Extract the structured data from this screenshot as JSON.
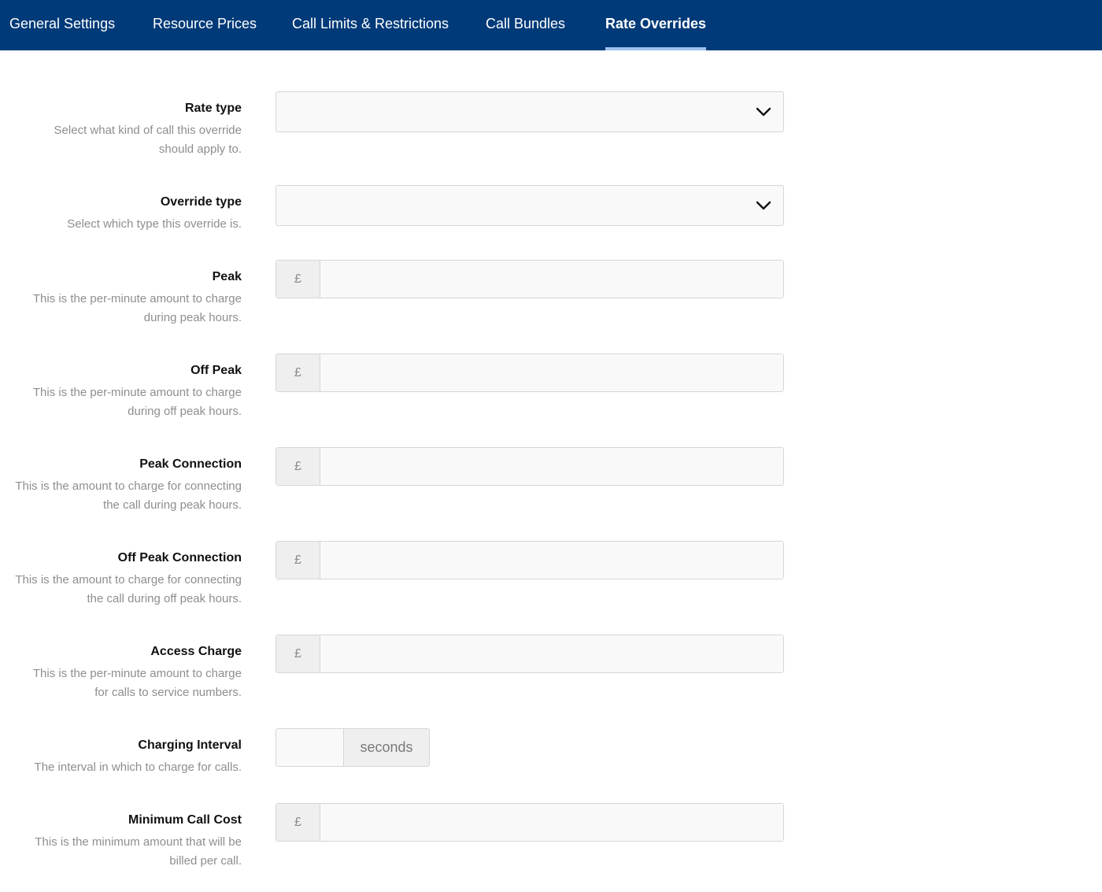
{
  "nav": {
    "tabs": [
      {
        "label": "General Settings"
      },
      {
        "label": "Resource Prices"
      },
      {
        "label": "Call Limits & Restrictions"
      },
      {
        "label": "Call Bundles"
      },
      {
        "label": "Rate Overrides"
      }
    ],
    "active_tab": "Rate Overrides"
  },
  "form": {
    "rate_type": {
      "label": "Rate type",
      "help": "Select what kind of call this override should apply to.",
      "value": ""
    },
    "override_type": {
      "label": "Override type",
      "help": "Select which type this override is.",
      "value": ""
    },
    "peak": {
      "label": "Peak",
      "help": "This is the per-minute amount to charge during peak hours.",
      "prefix": "£",
      "value": ""
    },
    "off_peak": {
      "label": "Off Peak",
      "help": "This is the per-minute amount to charge during off peak hours.",
      "prefix": "£",
      "value": ""
    },
    "peak_connection": {
      "label": "Peak Connection",
      "help": "This is the amount to charge for connecting the call during peak hours.",
      "prefix": "£",
      "value": ""
    },
    "off_peak_connection": {
      "label": "Off Peak Connection",
      "help": "This is the amount to charge for connecting the call during off peak hours.",
      "prefix": "£",
      "value": ""
    },
    "access_charge": {
      "label": "Access Charge",
      "help": "This is the per-minute amount to charge for calls to service numbers.",
      "prefix": "£",
      "value": ""
    },
    "charging_interval": {
      "label": "Charging Interval",
      "help": "The interval in which to charge for calls.",
      "suffix": "seconds",
      "value": ""
    },
    "minimum_call_cost": {
      "label": "Minimum Call Cost",
      "help": "This is the minimum amount that will be billed per call.",
      "prefix": "£",
      "value": ""
    }
  },
  "colors": {
    "nav_background": "#003a78",
    "active_tab_indicator": "#9cc2ee",
    "help_text": "#8e8e8e"
  }
}
